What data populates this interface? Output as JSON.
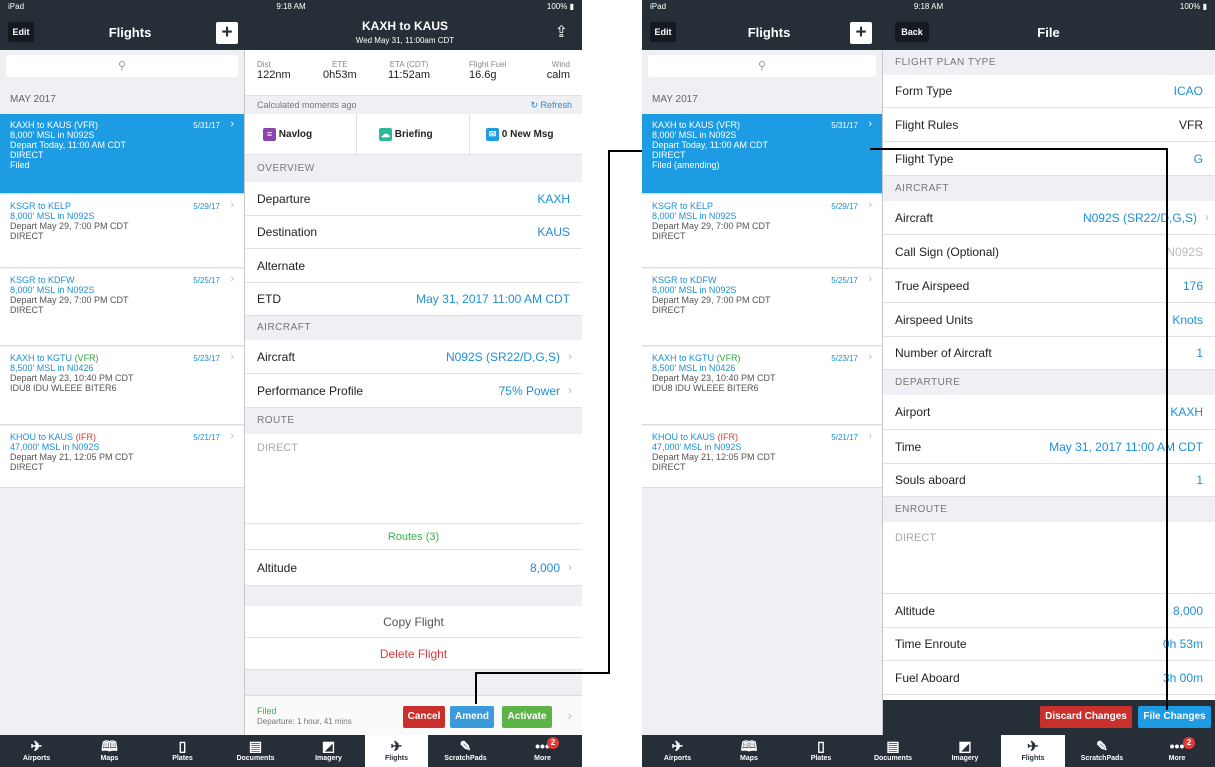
{
  "status": {
    "carrier": "iPad ",
    "time": "9:18 AM",
    "battery": "100%"
  },
  "left": {
    "nav": {
      "edit": "Edit",
      "title": "Flights",
      "plus": "+",
      "route_title": "KAXH to KAUS",
      "subtitle": "Wed May 31, 11:00am CDT",
      "share": "⇪"
    },
    "search_icon": "⚲",
    "month": "MAY 2017",
    "flights": [
      {
        "from": "KAXH",
        "to": "KAUS",
        "rules": "(VFR)",
        "date": "5/31/17",
        "alt": "8,000' MSL in N092S",
        "depart": "Depart Today, 11:00 AM CDT",
        "route": "DIRECT",
        "status": "Filed"
      },
      {
        "from": "KSGR",
        "to": "KELP",
        "rules": "",
        "date": "5/29/17",
        "alt": "8,000' MSL in N092S",
        "depart": "Depart May 29, 7:00 PM CDT",
        "route": "DIRECT"
      },
      {
        "from": "KSGR",
        "to": "KDFW",
        "rules": "",
        "date": "5/25/17",
        "alt": "8,000' MSL in N092S",
        "depart": "Depart May 29, 7:00 PM CDT",
        "route": "DIRECT"
      },
      {
        "from": "KAXH",
        "to": "KGTU",
        "rules": "(VFR)",
        "date": "5/23/17",
        "alt": "8,500' MSL in N0426",
        "depart": "Depart May 23, 10:40 PM CDT",
        "route": "IDU8 IDU WLEEE BITER6"
      },
      {
        "from": "KHOU",
        "to": "KAUS",
        "rules": "(IFR)",
        "date": "5/21/17",
        "alt": "47,000' MSL in N092S",
        "depart": "Depart May 21, 12:05 PM CDT",
        "route": "DIRECT"
      }
    ],
    "summary": [
      {
        "label": "Dist",
        "value": "122nm"
      },
      {
        "label": "ETE",
        "value": "0h53m"
      },
      {
        "label": "ETA (CDT)",
        "value": "11:52am"
      },
      {
        "label": "Flight Fuel",
        "value": "16.6g"
      },
      {
        "label": "Wind",
        "value": "calm"
      }
    ],
    "calculated": "Calculated moments ago",
    "refresh": "Refresh",
    "quick": [
      "Navlog",
      "Briefing",
      "0 New Msg"
    ],
    "sections": {
      "overview": "OVERVIEW",
      "aircraft": "AIRCRAFT",
      "route": "ROUTE"
    },
    "rows": {
      "departure": {
        "label": "Departure",
        "value": "KAXH"
      },
      "destination": {
        "label": "Destination",
        "value": "KAUS"
      },
      "alternate": {
        "label": "Alternate",
        "value": ""
      },
      "etd": {
        "label": "ETD",
        "value": "May 31, 2017 11:00 AM CDT"
      },
      "aircraft": {
        "label": "Aircraft",
        "value": "N092S (SR22/D,G,S)"
      },
      "performance": {
        "label": "Performance Profile",
        "value": "75% Power"
      },
      "altitude": {
        "label": "Altitude",
        "value": "8,000"
      }
    },
    "route_text": "DIRECT",
    "routes_button": "Routes (3)",
    "copy_flight": "Copy Flight",
    "delete_flight": "Delete Flight",
    "footer": {
      "status": "Filed",
      "departure": "Departure: 1 hour, 41 mins",
      "cancel": "Cancel",
      "amend": "Amend",
      "activate": "Activate"
    }
  },
  "right": {
    "nav": {
      "edit": "Edit",
      "title": "Flights",
      "plus": "+",
      "back": "Back",
      "file": "File"
    },
    "flight_status": "Filed (amending)",
    "sections": {
      "plan_type": "FLIGHT PLAN TYPE",
      "aircraft": "AIRCRAFT",
      "departure": "DEPARTURE",
      "enroute": "ENROUTE"
    },
    "rows": [
      {
        "label": "Form Type",
        "value": "ICAO"
      },
      {
        "label": "Flight Rules",
        "value": "VFR"
      },
      {
        "label": "Flight Type",
        "value": "G"
      },
      {
        "label": "Aircraft",
        "value": "N092S (SR22/D,G,S)"
      },
      {
        "label": "Call Sign (Optional)",
        "value": "N092S"
      },
      {
        "label": "True Airspeed",
        "value": "176"
      },
      {
        "label": "Airspeed Units",
        "value": "Knots"
      },
      {
        "label": "Number of Aircraft",
        "value": "1"
      },
      {
        "label": "Airport",
        "value": "KAXH"
      },
      {
        "label": "Time",
        "value": "May 31, 2017 11:00 AM CDT"
      },
      {
        "label": "Souls aboard",
        "value": "1"
      },
      {
        "label": "Altitude",
        "value": "8,000"
      },
      {
        "label": "Time Enroute",
        "value": "0h 53m"
      },
      {
        "label": "Fuel Aboard",
        "value": "3h 00m"
      }
    ],
    "enroute_text": "DIRECT",
    "discard": "Discard Changes",
    "file_changes": "File Changes"
  },
  "tabs": [
    {
      "label": "Airports",
      "icon": "✈"
    },
    {
      "label": "Maps",
      "icon": "🕮"
    },
    {
      "label": "Plates",
      "icon": "▯"
    },
    {
      "label": "Documents",
      "icon": "▤"
    },
    {
      "label": "Imagery",
      "icon": "◩"
    },
    {
      "label": "Flights",
      "icon": "✈"
    },
    {
      "label": "ScratchPads",
      "icon": "✎"
    },
    {
      "label": "More",
      "icon": "•••",
      "badge": "2"
    }
  ],
  "colors": {
    "navbar": "#262f38",
    "accent": "#1d9be3",
    "cancel": "#c9302c",
    "amend": "#3b9ad9",
    "activate": "#5cb346"
  }
}
